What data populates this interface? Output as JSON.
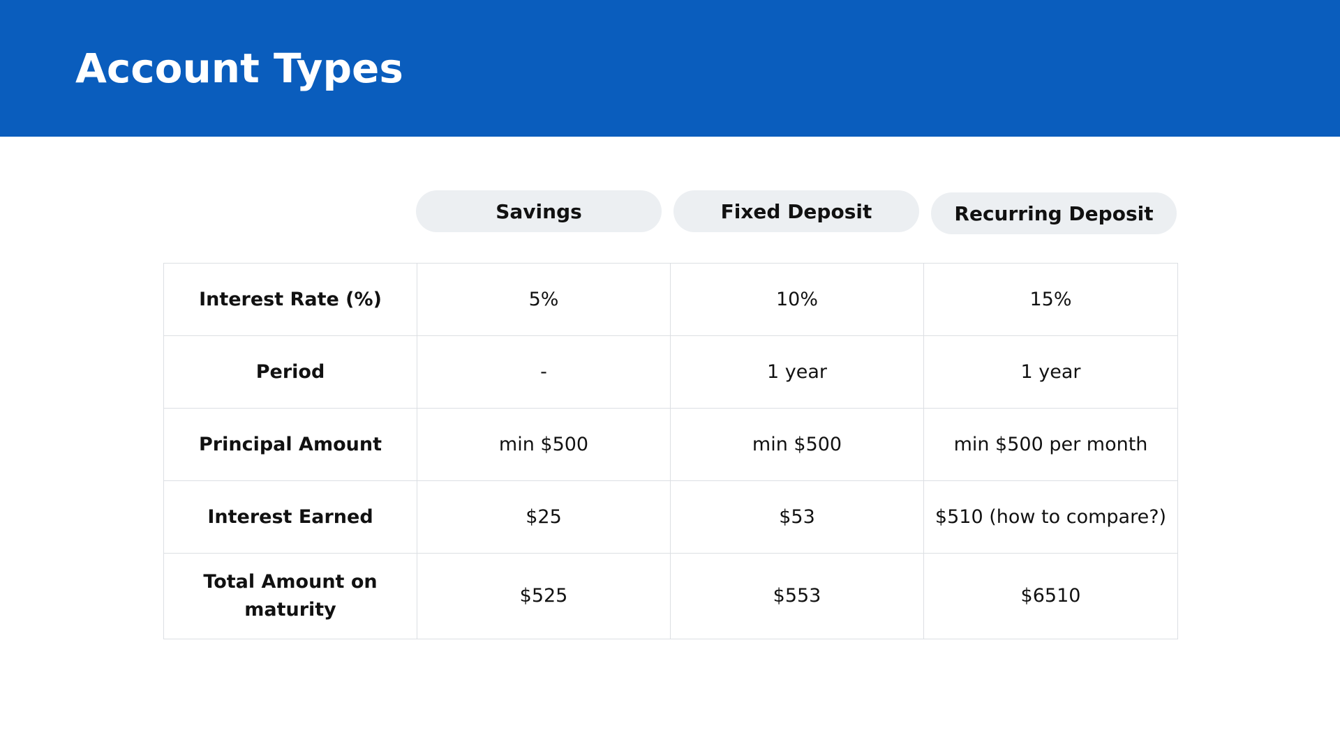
{
  "header": {
    "title": "Account Types",
    "background_color": "#0a5dbd"
  },
  "columns": [
    {
      "label": "Savings"
    },
    {
      "label": "Fixed Deposit"
    },
    {
      "label": "Recurring Deposit"
    }
  ],
  "rows": [
    {
      "label": "Interest Rate (%)",
      "values": [
        "5%",
        "10%",
        "15%"
      ]
    },
    {
      "label": "Period",
      "values": [
        "-",
        "1 year",
        "1 year"
      ]
    },
    {
      "label": "Principal Amount",
      "values": [
        "min $500",
        "min $500",
        "min $500 per month"
      ]
    },
    {
      "label": "Interest Earned",
      "values": [
        "$25",
        "$53",
        "$510 (how to compare?)"
      ]
    },
    {
      "label": "Total Amount on maturity",
      "values": [
        "$525",
        "$553",
        "$6510"
      ]
    }
  ]
}
